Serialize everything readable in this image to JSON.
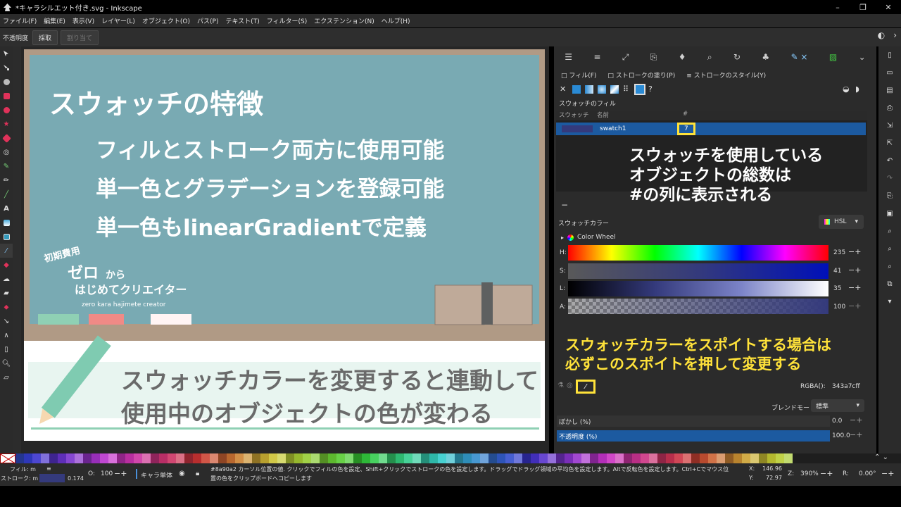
{
  "window": {
    "title": "*キャラシルエット付き.svg - Inkscape",
    "controls": [
      "–",
      "❐",
      "✕"
    ]
  },
  "menu": [
    "ファイル(F)",
    "編集(E)",
    "表示(V)",
    "レイヤー(L)",
    "オブジェクト(O)",
    "パス(P)",
    "テキスト(T)",
    "フィルター(S)",
    "エクステンション(N)",
    "ヘルプ(H)"
  ],
  "toolbar": {
    "opacity_label": "不透明度",
    "pick_button": "採取",
    "assign_button": "割り当て"
  },
  "slide": {
    "heading": "スウォッチの特徴",
    "lines": [
      "フィルとストローク両方に使用可能",
      "単一色とグラデーションを登録可能",
      "単一色もlinearGradientで定義"
    ],
    "logo_top": "初期費用",
    "logo_main": "ゼロ",
    "logo_from": "から",
    "logo_sub": "はじめてクリエイター",
    "logo_roman": "zero kara hajimete creator",
    "bottom_line1": "スウォッチカラーを変更すると連動して",
    "bottom_line2": "使用中のオブジェクトの色が変わる",
    "colors": {
      "bg": "#79aab3",
      "band": "#b09a85",
      "accent": "#7fcbb1",
      "pink": "#f08a86",
      "text": "#6a6a6a"
    }
  },
  "panel": {
    "fill_tab": "フィル(F)",
    "stroke_paint_tab": "ストロークの塗り(P)",
    "stroke_style_tab": "ストロークのスタイル(Y)",
    "unset": "?",
    "swatch_fill_title": "スウォッチのフィル",
    "table_headers": [
      "スウォッチ",
      "名前",
      "#"
    ],
    "swatch_row": {
      "name": "swatch1",
      "count": "7",
      "color": "#343a7c"
    },
    "annotation1": [
      "スウォッチを使用している",
      "オブジェクトの総数は",
      "#の列に表示される"
    ],
    "swatch_color_title": "スウォッチカラー",
    "mode": "HSL",
    "color_wheel": "Color Wheel",
    "sliders": [
      {
        "label": "H:",
        "value": "235"
      },
      {
        "label": "S:",
        "value": "41"
      },
      {
        "label": "L:",
        "value": "35"
      },
      {
        "label": "A:",
        "value": "100"
      }
    ],
    "annotation2": [
      "スウォッチカラーをスポイトする場合は",
      "必ずこのスポイトを押して変更する"
    ],
    "rgba_label": "RGBA():",
    "rgba_value": "343a7cff",
    "blend_label": "ブレンドモード:",
    "blend_value": "標準",
    "blur_label": "ぼかし (%)",
    "blur_value": "0.0",
    "opacity_label": "不透明度 (%)",
    "opacity_value": "100.0"
  },
  "status": {
    "fill_label": "フィル: m",
    "stroke_label": "ストローク: m L",
    "stroke_width": "0.174",
    "o_label": "O:",
    "o_value": "100",
    "layer": "キャラ単体",
    "message_line1": "#8a90a2 カーソル位置の値. クリックでフィルの色を設定、Shift+クリックでストロークの色を設定します。ドラッグでドラッグ領域の平均色を設定します。Altで反転色を設定します。Ctrl+Cでマウス位",
    "message_line2": "置の色をクリップボードへコピーします",
    "x_label": "X:",
    "x_value": "146.96",
    "y_label": "Y:",
    "y_value": "72.97",
    "z_label": "Z:",
    "zoom": "390%",
    "r_label": "R:",
    "rotation": "0.00°"
  }
}
